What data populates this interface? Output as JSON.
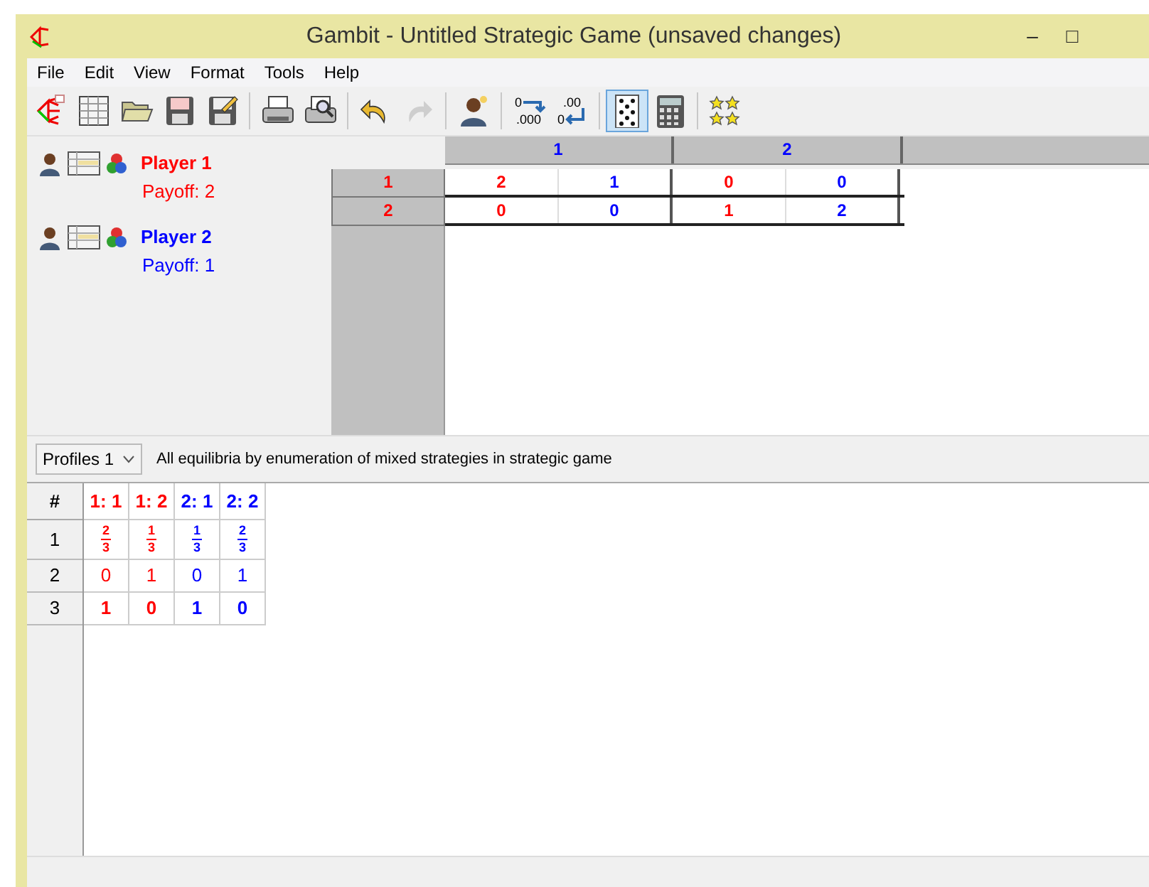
{
  "window": {
    "title": "Gambit - Untitled Strategic Game (unsaved changes)",
    "controls": [
      "–",
      "□"
    ]
  },
  "menu": [
    "File",
    "Edit",
    "View",
    "Format",
    "Tools",
    "Help"
  ],
  "toolbar": [
    [
      {
        "kind": "tree",
        "pressed": false
      },
      {
        "kind": "table",
        "pressed": false
      },
      {
        "kind": "folder",
        "pressed": false
      },
      {
        "kind": "disk",
        "pressed": false
      },
      {
        "kind": "disk-edit",
        "pressed": false
      }
    ],
    [
      {
        "kind": "printer",
        "pressed": false
      },
      {
        "kind": "preview",
        "pressed": false
      }
    ],
    [
      {
        "kind": "undo",
        "pressed": false
      },
      {
        "kind": "redo",
        "pressed": false,
        "disabled": true
      }
    ],
    [
      {
        "kind": "person",
        "pressed": false
      }
    ],
    [
      {
        "kind": "decimal-more",
        "pressed": false,
        "labels": [
          "0",
          ".000"
        ]
      },
      {
        "kind": "decimal-less",
        "pressed": false,
        "labels": [
          ".00",
          "0"
        ]
      }
    ],
    [
      {
        "kind": "card",
        "pressed": true
      },
      {
        "kind": "calculator",
        "pressed": false
      }
    ],
    [
      {
        "kind": "stars",
        "pressed": false
      }
    ]
  ],
  "players": [
    {
      "name": "Player 1",
      "payoff": "Payoff: 2",
      "color": "#ff0000"
    },
    {
      "name": "Player 2",
      "payoff": "Payoff: 1",
      "color": "#0000ff"
    }
  ],
  "game_table": {
    "column_strategies": [
      "1",
      "2"
    ],
    "rows": [
      {
        "label": "1",
        "cells": [
          [
            "2",
            "1"
          ],
          [
            "0",
            "0"
          ]
        ]
      },
      {
        "label": "2",
        "cells": [
          [
            "0",
            "0"
          ],
          [
            "1",
            "2"
          ]
        ]
      }
    ]
  },
  "profiles": {
    "selector": "Profiles 1",
    "description": "All equilibria by enumeration of mixed strategies in strategic game",
    "columns": [
      {
        "label": "#"
      },
      {
        "label": "1: 1",
        "color": "#ff0000"
      },
      {
        "label": "1: 2",
        "color": "#ff0000"
      },
      {
        "label": "2: 1",
        "color": "#0000ff"
      },
      {
        "label": "2: 2",
        "color": "#0000ff"
      }
    ],
    "rows": [
      {
        "label": "1",
        "bold": true,
        "values": [
          {
            "num": "2",
            "den": "3"
          },
          {
            "num": "1",
            "den": "3"
          },
          {
            "num": "1",
            "den": "3"
          },
          {
            "num": "2",
            "den": "3"
          }
        ]
      },
      {
        "label": "2",
        "bold": false,
        "values": [
          "0",
          "1",
          "0",
          "1"
        ]
      },
      {
        "label": "3",
        "bold": true,
        "values": [
          "1",
          "0",
          "1",
          "0"
        ]
      }
    ]
  }
}
